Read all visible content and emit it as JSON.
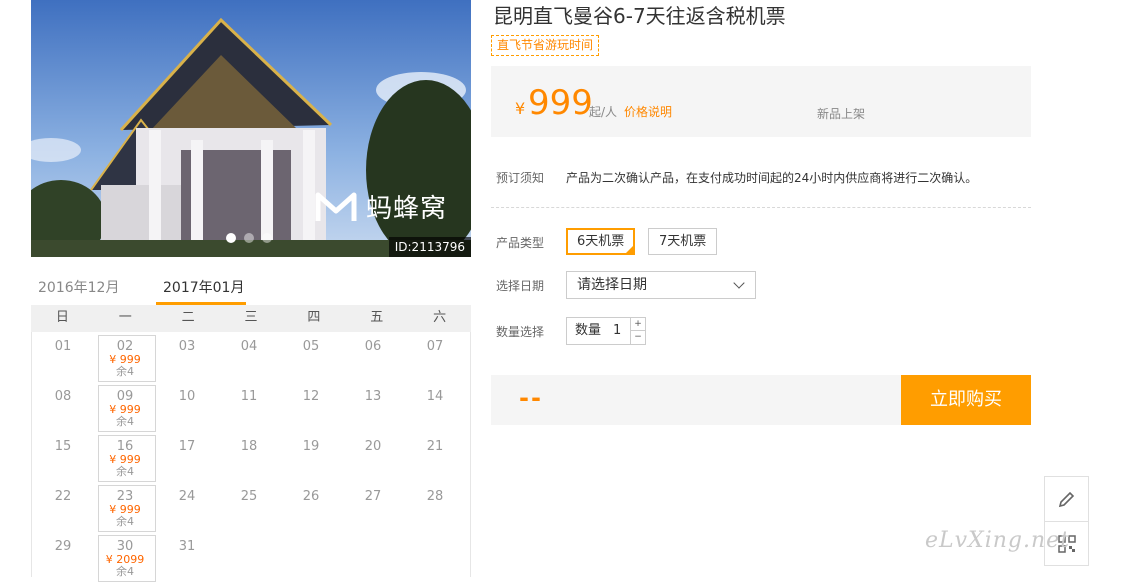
{
  "hero": {
    "image_id": "ID:2113796",
    "watermark_text": "蚂蜂窝",
    "slide_count": 3,
    "active_slide": 1
  },
  "calendar": {
    "tabs": [
      "2016年12月",
      "2017年01月"
    ],
    "active_tab": "2017年01月",
    "weekdays": [
      "日",
      "一",
      "二",
      "三",
      "四",
      "五",
      "六"
    ],
    "weeks": [
      [
        {
          "d": "01"
        },
        {
          "d": "02",
          "p": "¥ 999",
          "r": "余4"
        },
        {
          "d": "03"
        },
        {
          "d": "04"
        },
        {
          "d": "05"
        },
        {
          "d": "06"
        },
        {
          "d": "07"
        }
      ],
      [
        {
          "d": "08"
        },
        {
          "d": "09",
          "p": "¥ 999",
          "r": "余4"
        },
        {
          "d": "10"
        },
        {
          "d": "11"
        },
        {
          "d": "12"
        },
        {
          "d": "13"
        },
        {
          "d": "14"
        }
      ],
      [
        {
          "d": "15"
        },
        {
          "d": "16",
          "p": "¥ 999",
          "r": "余4"
        },
        {
          "d": "17"
        },
        {
          "d": "18"
        },
        {
          "d": "19"
        },
        {
          "d": "20"
        },
        {
          "d": "21"
        }
      ],
      [
        {
          "d": "22"
        },
        {
          "d": "23",
          "p": "¥ 999",
          "r": "余4"
        },
        {
          "d": "24"
        },
        {
          "d": "25"
        },
        {
          "d": "26"
        },
        {
          "d": "27"
        },
        {
          "d": "28"
        }
      ],
      [
        {
          "d": "29"
        },
        {
          "d": "30",
          "p": "¥ 2099",
          "r": "余4"
        },
        {
          "d": "31"
        },
        {
          "d": ""
        },
        {
          "d": ""
        },
        {
          "d": ""
        },
        {
          "d": ""
        }
      ]
    ]
  },
  "product": {
    "title": "昆明直飞曼谷6-7天往返含税机票",
    "tag": "直飞节省游玩时间",
    "currency": "¥",
    "price": "999",
    "per_person": "起/人",
    "price_explain": "价格说明",
    "new_label": "新品上架"
  },
  "booking": {
    "notice_label": "预订须知",
    "notice_text": "产品为二次确认产品，在支付成功时间起的24小时内供应商将进行二次确认。",
    "type_label": "产品类型",
    "types": [
      "6天机票",
      "7天机票"
    ],
    "selected_type": "6天机票",
    "date_label": "选择日期",
    "date_placeholder": "请选择日期",
    "qty_label": "数量选择",
    "qty_prefix": "数量",
    "qty_value": "1",
    "qty_up": "+",
    "qty_down": "−",
    "total": "--",
    "buy_label": "立即购买"
  },
  "site_watermark": "eLvXing.net",
  "colors": {
    "accent": "#ff9d00",
    "price": "#ff8800"
  }
}
